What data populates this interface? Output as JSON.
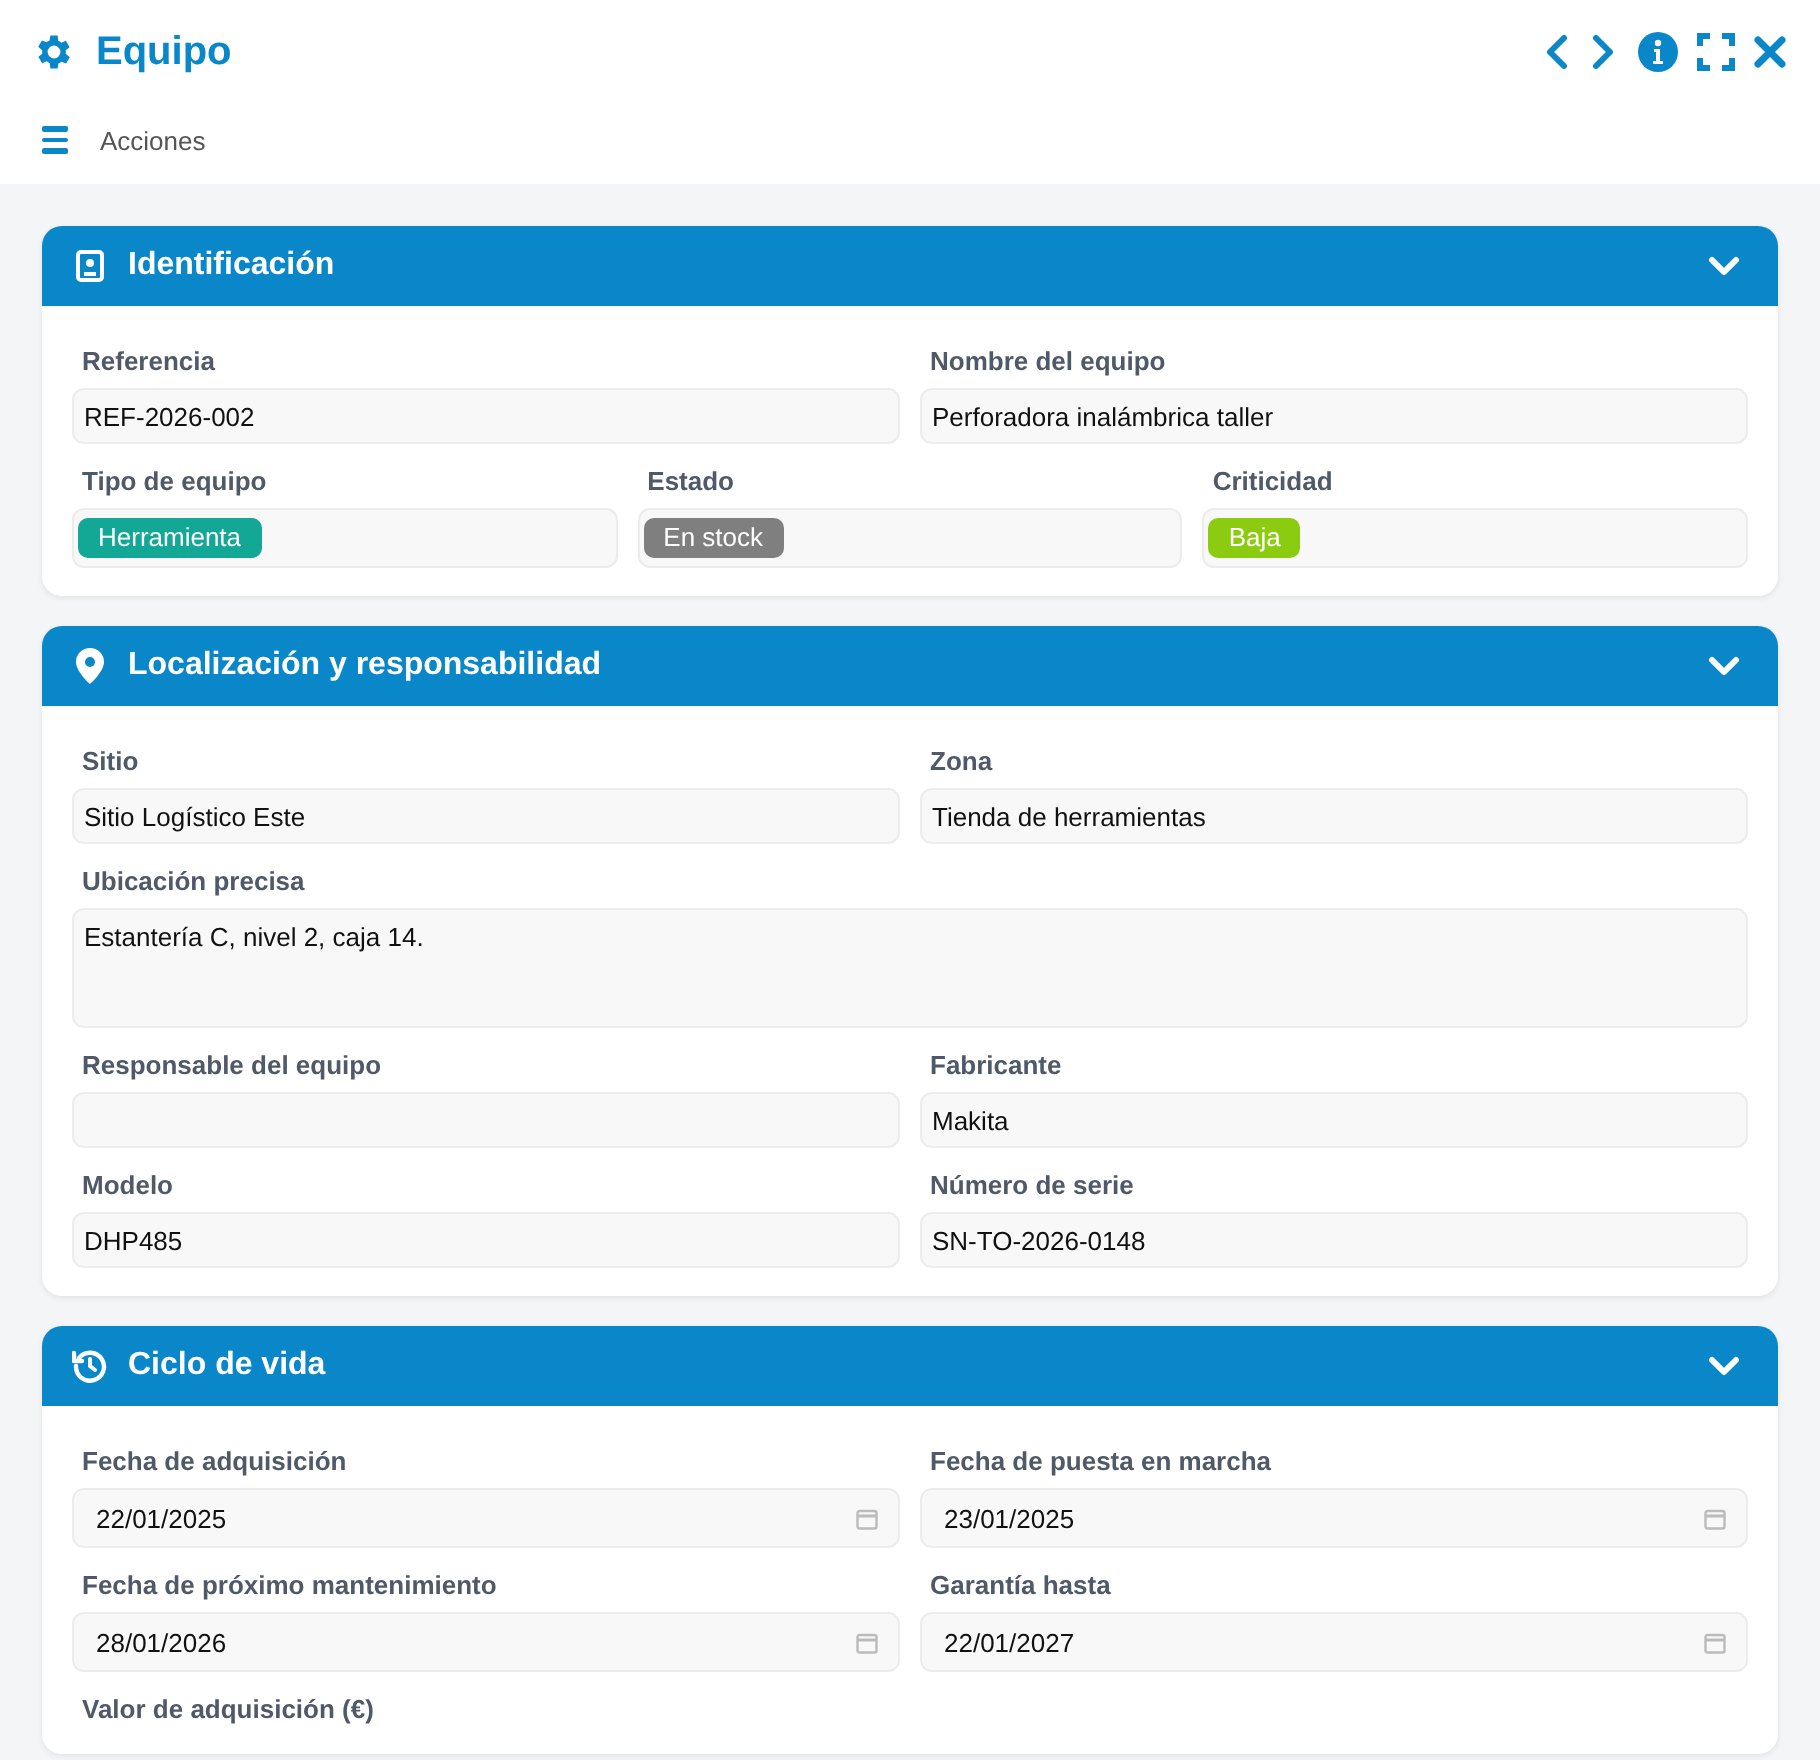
{
  "window": {
    "title": "Equipo"
  },
  "toolbar": {
    "menu_label": "Acciones"
  },
  "sections": [
    {
      "title": "Identificación",
      "expanded": true,
      "rows": [
        {
          "fields": [
            {
              "label": "Referencia",
              "kind": "text",
              "value": "REF-2026-002"
            },
            {
              "label": "Nombre del equipo",
              "kind": "text",
              "value": "Perforadora inalámbrica taller"
            }
          ]
        },
        {
          "fields": [
            {
              "label": "Tipo de equipo",
              "kind": "tag",
              "value": "Herramienta",
              "color": "#13a796"
            },
            {
              "label": "Estado",
              "kind": "tag",
              "value": "En stock",
              "color": "#7f7f7f"
            },
            {
              "label": "Criticidad",
              "kind": "tag",
              "value": "Baja",
              "color": "#8ccc10"
            }
          ]
        }
      ]
    },
    {
      "title": "Localización y responsabilidad",
      "expanded": true,
      "rows": [
        {
          "fields": [
            {
              "label": "Sitio",
              "kind": "text",
              "value": "Sitio Logístico Este"
            },
            {
              "label": "Zona",
              "kind": "text",
              "value": "Tienda de herramientas"
            }
          ]
        },
        {
          "fields": [
            {
              "label": "Ubicación precisa",
              "kind": "textarea",
              "value": "Estantería C, nivel 2, caja 14."
            }
          ]
        },
        {
          "fields": [
            {
              "label": "Responsable del equipo",
              "kind": "text"
            },
            {
              "label": "Fabricante",
              "kind": "text",
              "value": "Makita"
            }
          ]
        },
        {
          "fields": [
            {
              "label": "Modelo",
              "kind": "text",
              "value": "DHP485"
            },
            {
              "label": "Número de serie",
              "kind": "text",
              "value": "SN-TO-2026-0148"
            }
          ]
        }
      ]
    },
    {
      "title": "Ciclo de vida",
      "expanded": true,
      "rows": [
        {
          "fields": [
            {
              "label": "Fecha de adquisición",
              "kind": "date",
              "value": "22/01/2025"
            },
            {
              "label": "Fecha de puesta en marcha",
              "kind": "date",
              "value": "23/01/2025"
            }
          ]
        },
        {
          "fields": [
            {
              "label": "Fecha de próximo mantenimiento",
              "kind": "date",
              "value": "28/01/2026"
            },
            {
              "label": "Garantía hasta",
              "kind": "date",
              "value": "22/01/2027"
            }
          ]
        },
        {
          "fields": [
            {
              "label": "Valor de adquisición (€)",
              "kind": "label"
            }
          ]
        }
      ]
    }
  ]
}
